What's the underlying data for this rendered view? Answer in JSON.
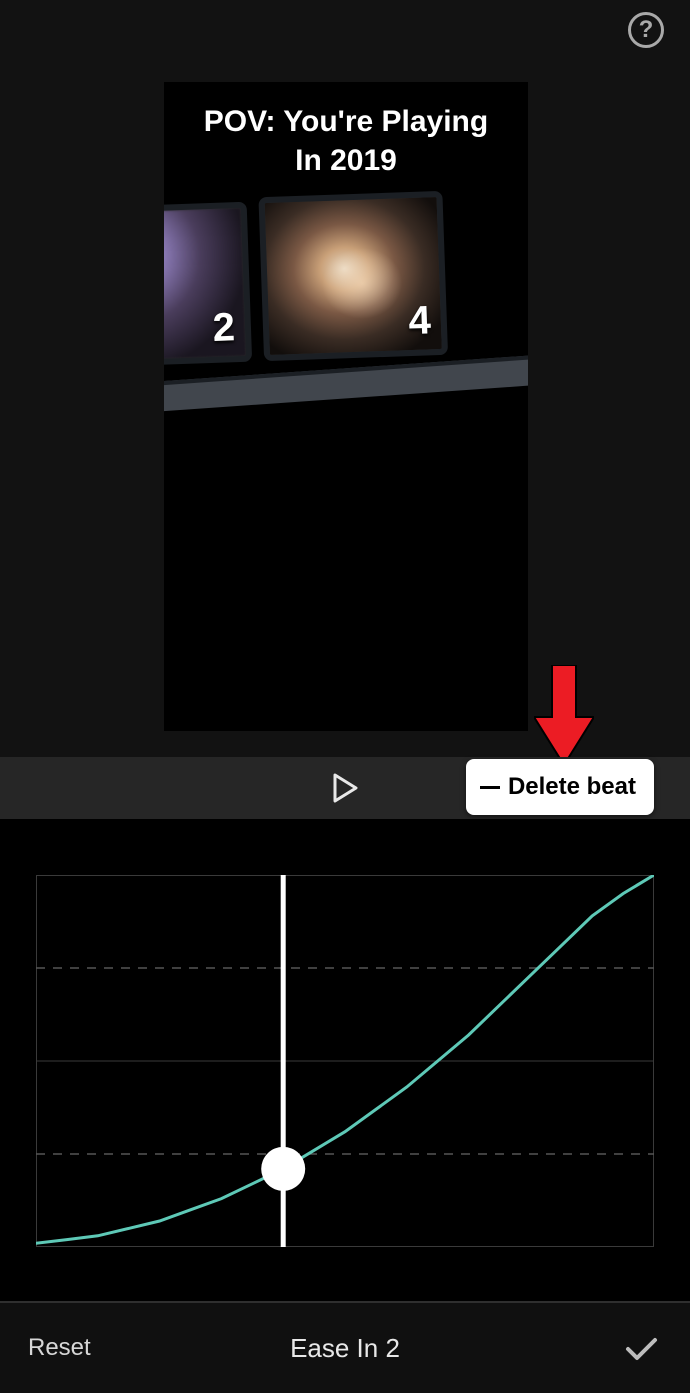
{
  "help": {
    "glyph": "?"
  },
  "preview": {
    "caption": "POV: You're  Playing\nIn 2019",
    "thumbs": [
      {
        "number": "2"
      },
      {
        "number": "4"
      }
    ]
  },
  "playbar": {
    "delete_beat_label": "Delete beat"
  },
  "curve": {
    "mode_label": "Ease In 2"
  },
  "bottom": {
    "reset_label": "Reset"
  },
  "annotations": {
    "arrow_color": "#ec1c24"
  },
  "chart_data": {
    "type": "line",
    "title": "",
    "xlabel": "",
    "ylabel": "",
    "xlim": [
      0,
      1
    ],
    "ylim": [
      0,
      1
    ],
    "gridlines_y": [
      0.25,
      0.5,
      0.75
    ],
    "playhead_x": 0.4,
    "handle": {
      "x": 0.4,
      "y": 0.21
    },
    "series": [
      {
        "name": "Ease In 2",
        "color": "#5ec9b7",
        "x": [
          0.0,
          0.05,
          0.1,
          0.15,
          0.2,
          0.25,
          0.3,
          0.35,
          0.4,
          0.45,
          0.5,
          0.55,
          0.6,
          0.65,
          0.7,
          0.75,
          0.8,
          0.85,
          0.9,
          0.95,
          1.0
        ],
        "y": [
          0.01,
          0.02,
          0.03,
          0.05,
          0.07,
          0.1,
          0.13,
          0.17,
          0.21,
          0.26,
          0.31,
          0.37,
          0.43,
          0.5,
          0.57,
          0.65,
          0.73,
          0.81,
          0.89,
          0.95,
          1.0
        ]
      }
    ]
  }
}
